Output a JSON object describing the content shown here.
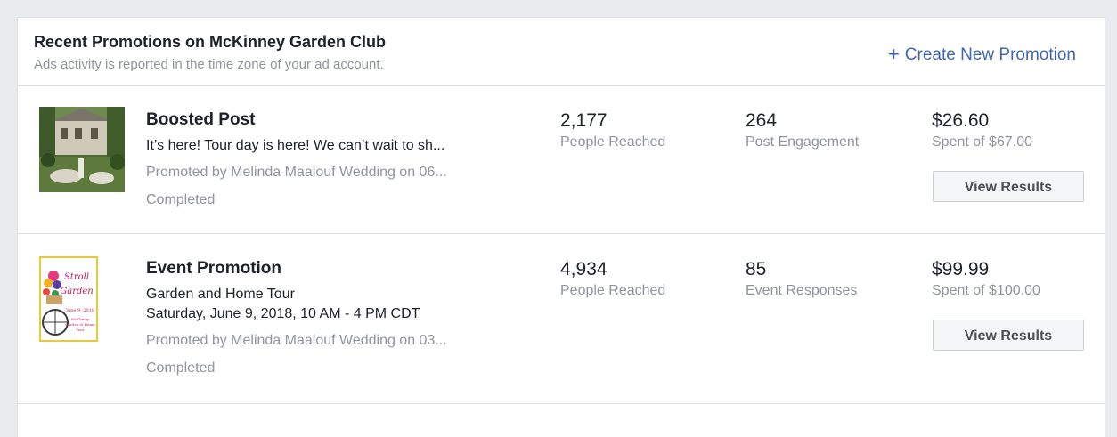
{
  "header": {
    "title": "Recent Promotions on McKinney Garden Club",
    "subtitle": "Ads activity is reported in the time zone of your ad account.",
    "create_label": "Create New Promotion",
    "create_icon": "plus-icon"
  },
  "promotions": [
    {
      "type": "Boosted Post",
      "line1": "It’s here! Tour day is here! We can’t wait to sh...",
      "promoted": "Promoted by Melinda Maalouf Wedding on 06...",
      "status": "Completed",
      "stat1_value": "2,177",
      "stat1_label": "People Reached",
      "stat2_value": "264",
      "stat2_label": "Post Engagement",
      "stat3_value": "$26.60",
      "stat3_label": "Spent of $67.00",
      "button_label": "View Results"
    },
    {
      "type": "Event Promotion",
      "line1": "Garden and Home Tour",
      "line2": "Saturday, June 9, 2018, 10 AM - 4 PM CDT",
      "promoted": "Promoted by Melinda Maalouf Wedding on 03...",
      "status": "Completed",
      "stat1_value": "4,934",
      "stat1_label": "People Reached",
      "stat2_value": "85",
      "stat2_label": "Event Responses",
      "stat3_value": "$99.99",
      "stat3_label": "Spent of $100.00",
      "button_label": "View Results",
      "thumb_text": {
        "top": "Stroll",
        "middle": "Garden",
        "date": "June 9, 2018",
        "org1": "McKinney",
        "org2": "Garden & Home",
        "org3": "Tour"
      }
    }
  ],
  "colors": {
    "link": "#4267b2",
    "muted": "#90949c",
    "text": "#1d2129",
    "border": "#dddfe2"
  }
}
